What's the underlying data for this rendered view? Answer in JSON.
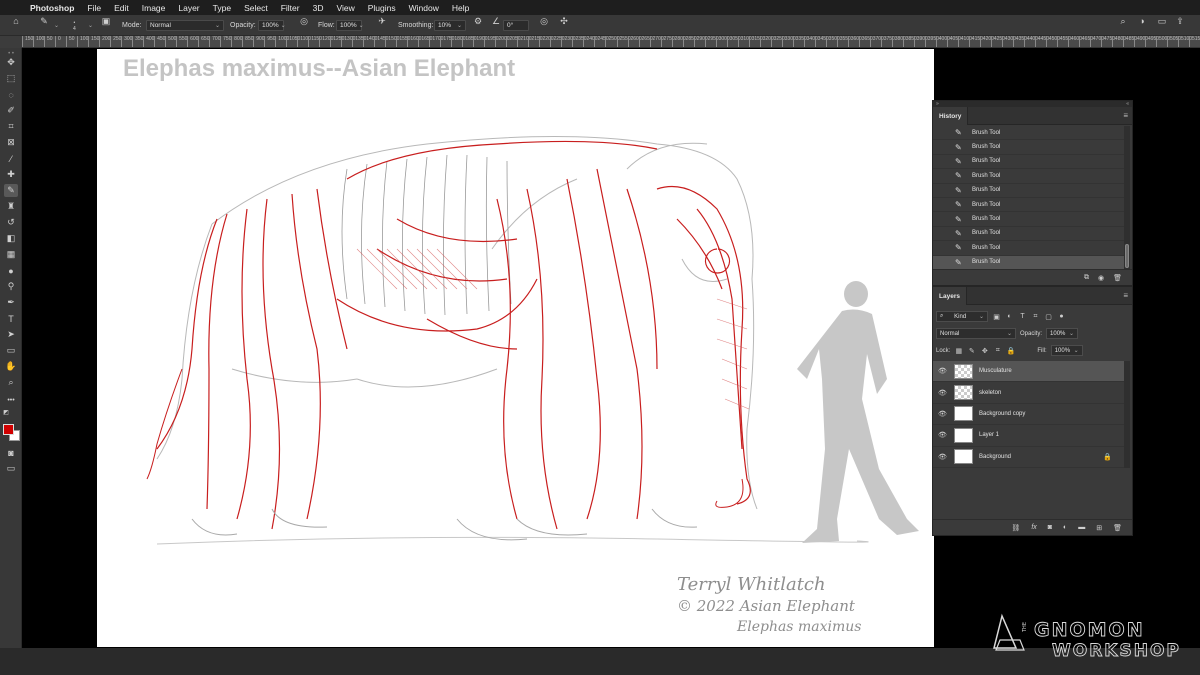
{
  "menubar": {
    "items": [
      "Photoshop",
      "File",
      "Edit",
      "Image",
      "Layer",
      "Type",
      "Select",
      "Filter",
      "3D",
      "View",
      "Plugins",
      "Window",
      "Help"
    ]
  },
  "options": {
    "brush_size": "4",
    "mode_label": "Mode:",
    "mode_value": "Normal",
    "opacity_label": "Opacity:",
    "opacity_value": "100%",
    "flow_label": "Flow:",
    "flow_value": "100%",
    "smoothing_label": "Smoothing:",
    "smoothing_value": "10%",
    "angle_value": "0°"
  },
  "ruler": {
    "ticks": [
      "150",
      "100",
      "50",
      "0",
      "50",
      "100",
      "150",
      "200",
      "250",
      "300",
      "350",
      "400",
      "450",
      "500",
      "550",
      "600",
      "650",
      "700",
      "750",
      "800",
      "850",
      "900",
      "950",
      "1000",
      "1050",
      "1100",
      "1150",
      "1200",
      "1250",
      "1300",
      "1350",
      "1400",
      "1450",
      "1500",
      "1550",
      "1600",
      "1650",
      "1700",
      "1750",
      "1800",
      "1850",
      "1900",
      "1950",
      "2000",
      "2050",
      "2100",
      "2150",
      "2200",
      "2250",
      "2300",
      "2350",
      "2400",
      "2450",
      "2500",
      "2550",
      "2600",
      "2650",
      "2700",
      "2750",
      "2800",
      "2850",
      "2900",
      "2950",
      "3000",
      "3050",
      "3100",
      "3150",
      "3200",
      "3250",
      "3300",
      "3350",
      "3400",
      "3450",
      "3500",
      "3550",
      "3600",
      "3650",
      "3700",
      "3750",
      "3800",
      "3850",
      "3900",
      "3950",
      "4000",
      "4050",
      "4100",
      "4150",
      "4200",
      "4250",
      "4300",
      "4350",
      "4400",
      "4450",
      "4500",
      "4550",
      "4600",
      "4650",
      "4700",
      "4750",
      "4800",
      "4850",
      "4900",
      "4950",
      "5000",
      "5050",
      "5100",
      "5150"
    ]
  },
  "canvas": {
    "title": "Elephas maximus--Asian Elephant",
    "signature_line1": "Terryl Whitlatch",
    "signature_line2": "© 2022 Asian Elephant",
    "signature_line3": "Elephas maximus"
  },
  "history": {
    "title": "History",
    "items": [
      "Brush Tool",
      "Brush Tool",
      "Brush Tool",
      "Brush Tool",
      "Brush Tool",
      "Brush Tool",
      "Brush Tool",
      "Brush Tool",
      "Brush Tool",
      "Brush Tool"
    ]
  },
  "layers": {
    "title": "Layers",
    "filter_kind": "Kind",
    "blend_mode": "Normal",
    "opacity_label": "Opacity:",
    "opacity_value": "100%",
    "lock_label": "Lock:",
    "fill_label": "Fill:",
    "fill_value": "100%",
    "items": [
      {
        "name": "Musculature"
      },
      {
        "name": "skeleton"
      },
      {
        "name": "Background copy"
      },
      {
        "name": "Layer 1"
      },
      {
        "name": "Background"
      }
    ]
  },
  "colors": {
    "foreground": "#d00000",
    "background": "#ffffff"
  }
}
